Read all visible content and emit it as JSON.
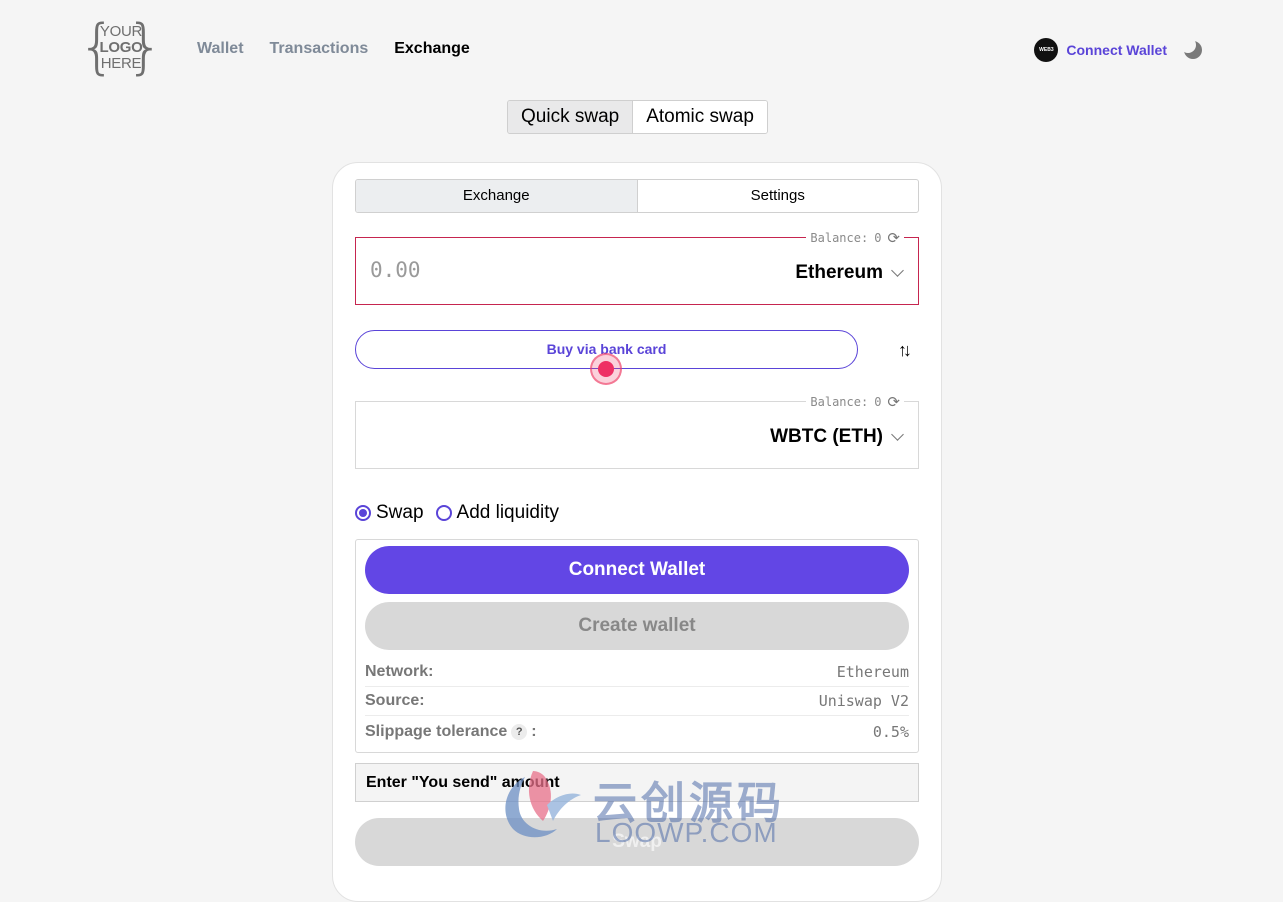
{
  "header": {
    "logo_text": [
      "YOUR",
      "LOGO",
      "HERE"
    ],
    "nav": [
      {
        "label": "Wallet",
        "active": false
      },
      {
        "label": "Transactions",
        "active": false
      },
      {
        "label": "Exchange",
        "active": true
      }
    ],
    "web3_badge": "WEB3",
    "connect_label": "Connect Wallet",
    "theme_icon": "moon-icon"
  },
  "mode_toggle": {
    "options": [
      "Quick swap",
      "Atomic swap"
    ],
    "selected": "Quick swap"
  },
  "card": {
    "tabs": [
      "Exchange",
      "Settings"
    ],
    "active_tab": "Exchange",
    "send": {
      "balance_label": "Balance:",
      "balance_value": "0",
      "amount_placeholder": "0.00",
      "token": "Ethereum"
    },
    "buy_label": "Buy via bank card",
    "receive": {
      "balance_label": "Balance:",
      "balance_value": "0",
      "token": "WBTC (ETH)"
    },
    "radios": [
      {
        "label": "Swap",
        "checked": true
      },
      {
        "label": "Add liquidity",
        "checked": false
      }
    ],
    "connect_label": "Connect Wallet",
    "create_label": "Create wallet",
    "info": [
      {
        "key": "Network:",
        "value": "Ethereum"
      },
      {
        "key": "Source:",
        "value": "Uniswap V2"
      },
      {
        "key": "Slippage tolerance",
        "value": "0.5%"
      }
    ],
    "slippage_help": "?",
    "slippage_colon": ":",
    "notice": "Enter \"You send\" amount",
    "swap_label": "Swap"
  },
  "watermark": {
    "cn": "云创源码",
    "en": "LOOWP.COM"
  },
  "colors": {
    "accent": "#6246e5",
    "link": "#5a44d8",
    "error_border": "#c6254f",
    "disabled": "#d8d8d8"
  }
}
